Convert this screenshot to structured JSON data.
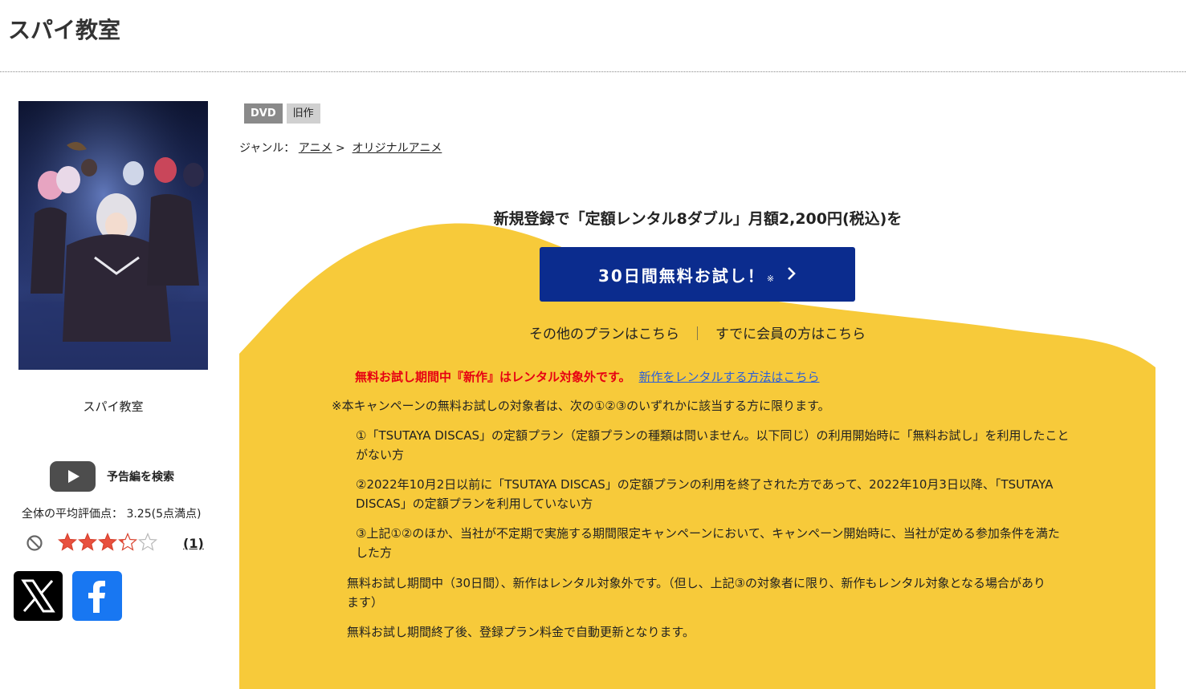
{
  "page": {
    "title": "スパイ教室"
  },
  "product": {
    "jacket_caption": "スパイ教室",
    "trailer_label": "予告編を検索",
    "average_rating_text": "全体の平均評価点： 3.25(5点満点)",
    "rating_value": 3.25,
    "rating_max": 5,
    "review_count": "(1)"
  },
  "share": {
    "x_icon": "x-logo-icon",
    "facebook_icon": "facebook-logo-icon"
  },
  "tags": {
    "dvd": "DVD",
    "old": "旧作"
  },
  "genre": {
    "label": "ジャンル：",
    "level1": "アニメ",
    "separator": ">",
    "level2": "オリジナルアニメ"
  },
  "campaign": {
    "heading": "新規登録で「定額レンタル8ダブル」月額2,200円(税込)を",
    "cta_label": "30日間無料お試し！",
    "cta_note": "※",
    "other_plans": "その他のプランはこちら",
    "separator": "｜",
    "members": "すでに会員の方はこちら",
    "warning": "無料お試し期間中『新作』はレンタル対象外です。",
    "warning_link": "新作をレンタルする方法はこちら",
    "intro": "※本キャンペーンの無料お試しの対象者は、次の①②③のいずれかに該当する方に限ります。",
    "conditions": [
      "①「TSUTAYA DISCAS」の定額プラン（定額プランの種類は問いません。以下同じ）の利用開始時に「無料お試し」を利用したことがない方",
      "②2022年10月2日以前に「TSUTAYA DISCAS」の定額プランの利用を終了された方であって、2022年10月3日以降、「TSUTAYA DISCAS」の定額プランを利用していない方",
      "③上記①②のほか、当社が不定期で実施する期間限定キャンペーンにおいて、キャンペーン開始時に、当社が定める参加条件を満たした方"
    ],
    "footnotes": [
      "無料お試し期間中（30日間）、新作はレンタル対象外です。（但し、上記③の対象者に限り、新作もレンタル対象となる場合があります）",
      "無料お試し期間終了後、登録プラン料金で自動更新となります。"
    ]
  },
  "colors": {
    "campaign_yellow": "#f7ca3a",
    "cta_blue": "#0b2c8e",
    "warning_red": "#e60012",
    "link_blue": "#2b5fd9"
  }
}
